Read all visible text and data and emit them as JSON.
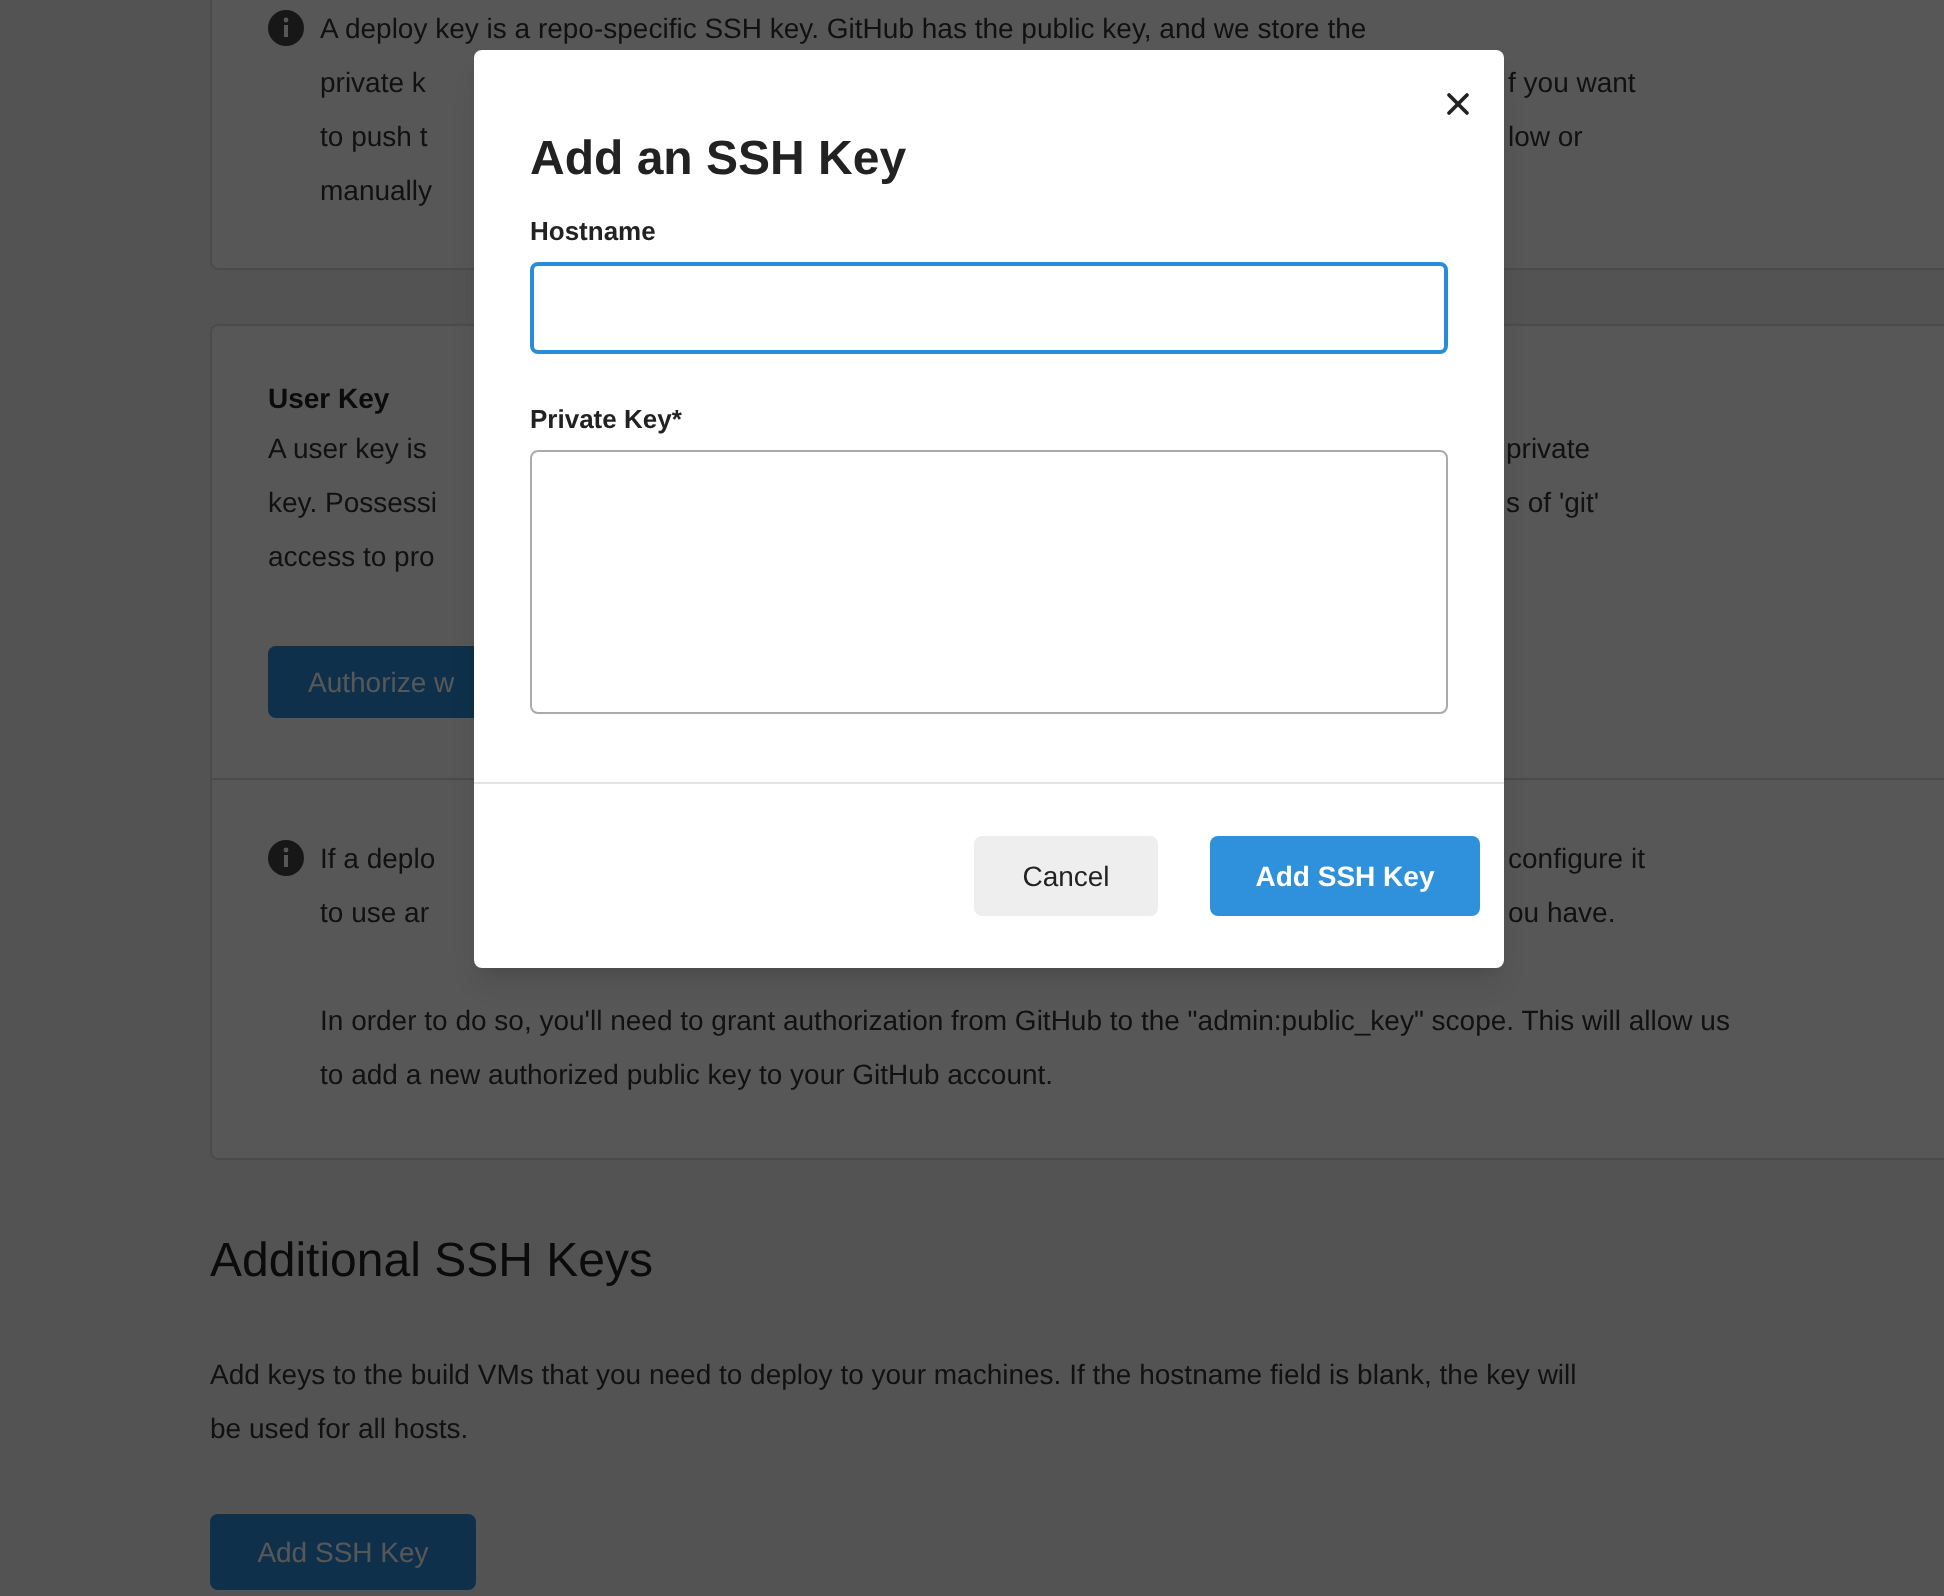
{
  "background": {
    "deploy_key_card": {
      "lines": [
        {
          "left": "A deploy key is a repo-specific SSH key. GitHub has the public key, and we store the"
        },
        {
          "left": "private k",
          "right": "f you want"
        },
        {
          "left": "to push t",
          "right": "low or"
        },
        {
          "left": "manually"
        }
      ]
    },
    "user_key_card": {
      "title": "User Key",
      "lines": [
        {
          "left": "A user key is",
          "right": "private"
        },
        {
          "left": "key. Possessi",
          "right": "s of 'git'"
        },
        {
          "left": "access to pro"
        }
      ],
      "authorize_button": "Authorize w",
      "notice_lines": [
        {
          "left": "If a deplo",
          "right": "configure it"
        },
        {
          "left": "to use ar",
          "right": "ou have."
        }
      ],
      "notice_paragraph": "In order to do so, you'll need to grant authorization from GitHub to the \"admin:public_key\" scope. This will allow us to add a new authorized public key to your GitHub account."
    },
    "additional_keys": {
      "heading": "Additional SSH Keys",
      "description": "Add keys to the build VMs that you need to deploy to your machines. If the hostname field is blank, the key will be used for all hosts.",
      "button": "Add SSH Key"
    }
  },
  "modal": {
    "title": "Add an SSH Key",
    "fields": [
      {
        "kind": "input",
        "label": "Hostname",
        "focused": true
      },
      {
        "kind": "textarea",
        "label": "Private Key*",
        "focused": false
      }
    ],
    "cancel_button": "Cancel",
    "submit_button": "Add SSH Key"
  }
}
